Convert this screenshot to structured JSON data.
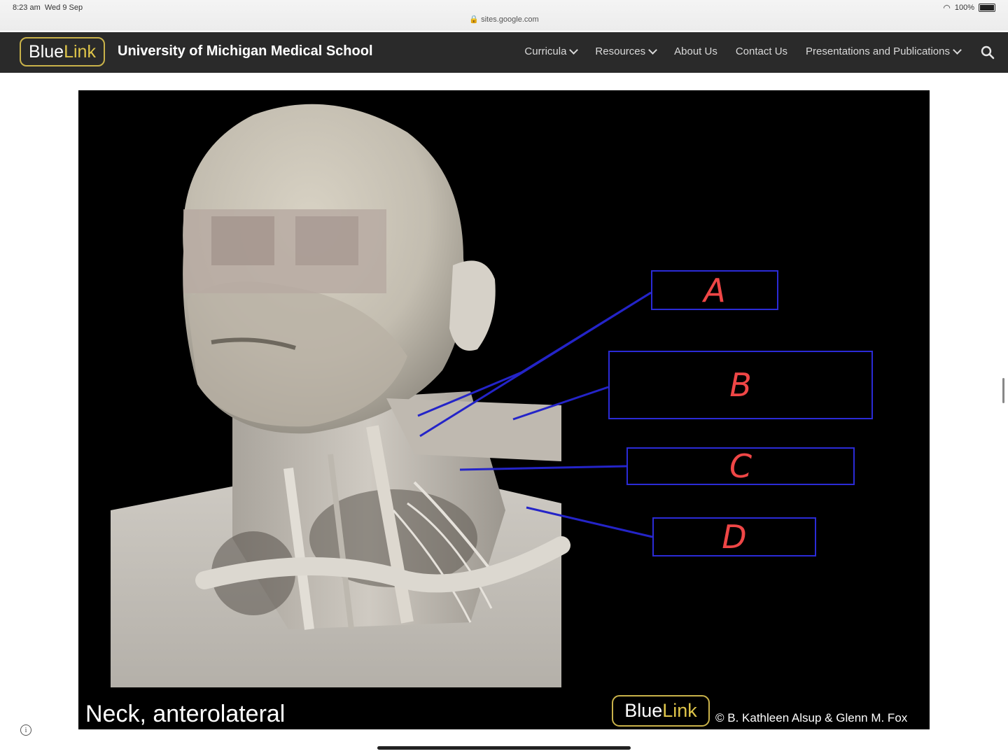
{
  "status_bar": {
    "time": "8:23 am",
    "date": "Wed 9 Sep",
    "url": "sites.google.com",
    "battery": "100%"
  },
  "nav": {
    "logo_blue": "Blue",
    "logo_link": "Link",
    "site_title": "University of Michigan Medical School",
    "links": [
      "Curricula",
      "Resources",
      "About Us",
      "Contact Us",
      "Presentations and Publications"
    ]
  },
  "slide": {
    "labels": [
      "A",
      "B",
      "C",
      "D"
    ],
    "caption": "Neck, anterolateral",
    "logo_blue": "Blue",
    "logo_link": "Link",
    "credit": "© B. Kathleen Alsup & Glenn M. Fox"
  },
  "colors": {
    "navbar": "#2a2a2a",
    "logo_accent": "#e0c64a",
    "label_border": "#2b2bd6",
    "label_text": "#ef4646",
    "leader_line": "#2424c8"
  },
  "icons": [
    "lock-icon",
    "wifi-icon",
    "battery-icon",
    "chevron-down-icon",
    "search-icon",
    "info-icon"
  ]
}
